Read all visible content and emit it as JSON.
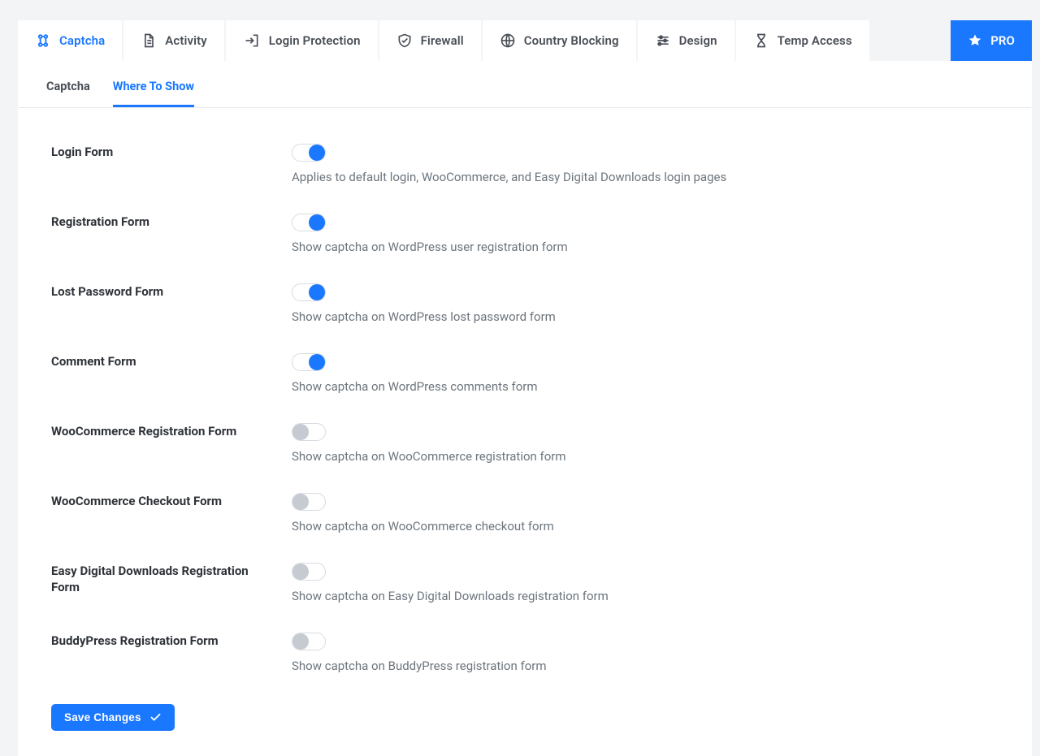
{
  "colors": {
    "accent": "#1a78ff"
  },
  "tabs": {
    "captcha": {
      "label": "Captcha",
      "icon": "captcha-icon",
      "active": true
    },
    "activity": {
      "label": "Activity",
      "icon": "document-icon",
      "active": false
    },
    "login": {
      "label": "Login Protection",
      "icon": "login-icon",
      "active": false
    },
    "firewall": {
      "label": "Firewall",
      "icon": "shield-icon",
      "active": false
    },
    "country": {
      "label": "Country Blocking",
      "icon": "globe-icon",
      "active": false
    },
    "design": {
      "label": "Design",
      "icon": "sliders-icon",
      "active": false
    },
    "temp": {
      "label": "Temp Access",
      "icon": "hourglass-icon",
      "active": false
    },
    "pro": {
      "label": "PRO",
      "icon": "star-icon",
      "active": false
    }
  },
  "subtabs": {
    "captcha": {
      "label": "Captcha",
      "active": false
    },
    "where": {
      "label": "Where To Show",
      "active": true
    }
  },
  "settings": {
    "login": {
      "label": "Login Form",
      "help": "Applies to default login, WooCommerce, and Easy Digital Downloads login pages",
      "on": true
    },
    "register": {
      "label": "Registration Form",
      "help": "Show captcha on WordPress user registration form",
      "on": true
    },
    "lost": {
      "label": "Lost Password Form",
      "help": "Show captcha on WordPress lost password form",
      "on": true
    },
    "comment": {
      "label": "Comment Form",
      "help": "Show captcha on WordPress comments form",
      "on": true
    },
    "woo_reg": {
      "label": "WooCommerce Registration Form",
      "help": "Show captcha on WooCommerce registration form",
      "on": false
    },
    "woo_co": {
      "label": "WooCommerce Checkout Form",
      "help": "Show captcha on WooCommerce checkout form",
      "on": false
    },
    "edd_reg": {
      "label": "Easy Digital Downloads Registration Form",
      "help": "Show captcha on Easy Digital Downloads registration form",
      "on": false
    },
    "bp_reg": {
      "label": "BuddyPress Registration Form",
      "help": "Show captcha on BuddyPress registration form",
      "on": false
    }
  },
  "actions": {
    "save": "Save Changes"
  }
}
